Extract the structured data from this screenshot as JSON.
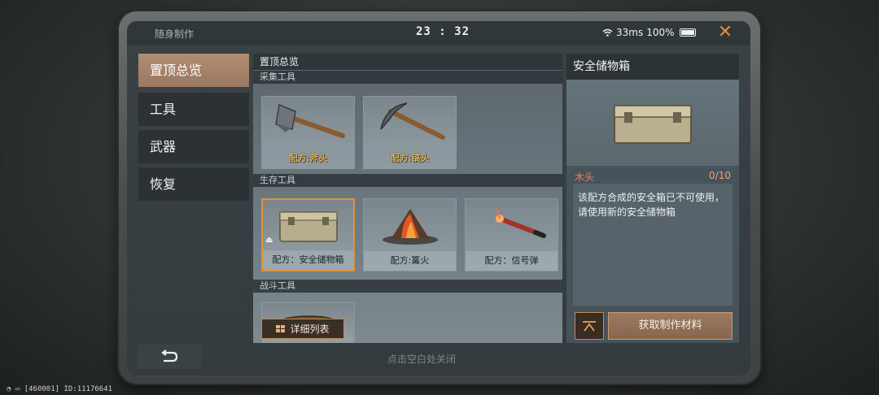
{
  "topbar": {
    "app_title": "随身制作",
    "clock": "23 : 32",
    "ping": "33ms",
    "battery": "100%"
  },
  "nav": {
    "items": [
      {
        "label": "置顶总览",
        "active": true
      },
      {
        "label": "工具",
        "active": false
      },
      {
        "label": "武器",
        "active": false
      },
      {
        "label": "恢复",
        "active": false
      }
    ]
  },
  "center": {
    "header": "置顶总览",
    "sections": [
      {
        "title": "采集工具",
        "cards": [
          {
            "label": "配方:斧头"
          },
          {
            "label": "配方:镐头"
          }
        ]
      },
      {
        "title": "生存工具",
        "cards": [
          {
            "label": "配方：安全储物箱"
          },
          {
            "label": "配方:篝火"
          },
          {
            "label": "配方：信号弹"
          }
        ]
      },
      {
        "title": "战斗工具",
        "cards": []
      }
    ],
    "detail_list_label": "详细列表"
  },
  "detail": {
    "title": "安全储物箱",
    "material_name": "木头",
    "material_count": "0/10",
    "description": "该配方合成的安全箱已不可使用，请使用新的安全储物箱",
    "get_material_label": "获取制作材料"
  },
  "footer": {
    "hint": "点击空白处关闭",
    "device_info": "[460001] ID:11176641"
  },
  "colors": {
    "accent": "#e0923e",
    "nav_active": "#a8846b",
    "material_red": "#ff7a5a"
  }
}
